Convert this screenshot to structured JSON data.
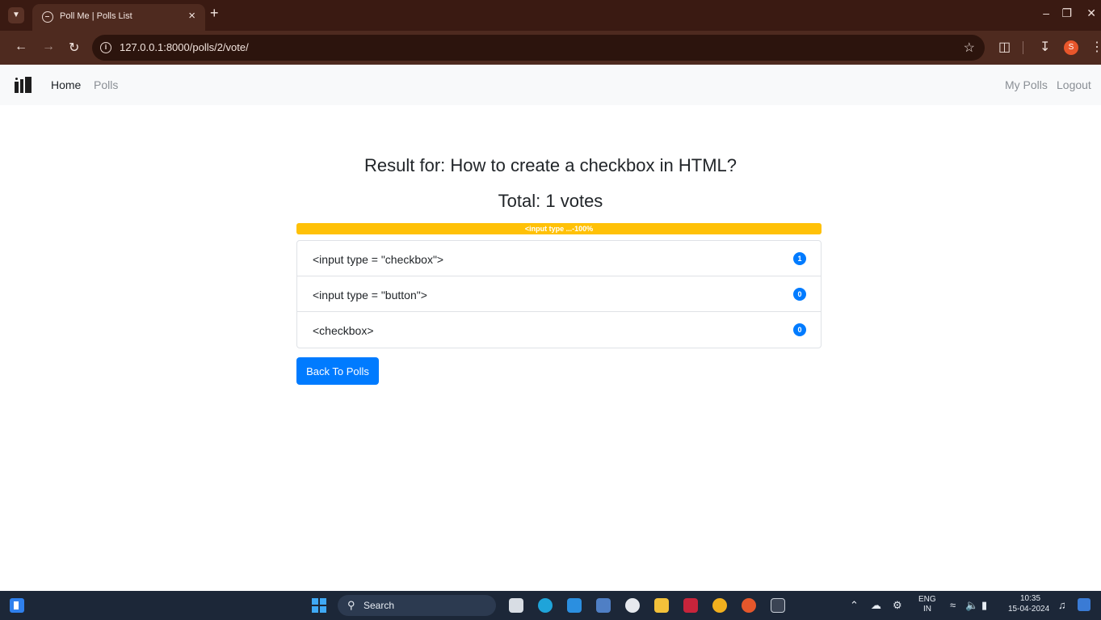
{
  "browser": {
    "tab_title": "Poll Me | Polls List",
    "url": "127.0.0.1:8000/polls/2/vote/",
    "profile_initial": "S"
  },
  "navbar": {
    "home": "Home",
    "polls": "Polls",
    "my_polls": "My Polls",
    "logout": "Logout"
  },
  "main": {
    "result_title": "Result for: How to create a checkbox in HTML?",
    "total": "Total: 1 votes",
    "progress_label": "<input type ...-100%",
    "progress_percent": 100,
    "choices": [
      {
        "text": "<input type = \"checkbox\">",
        "votes": "1"
      },
      {
        "text": "<input type = \"button\">",
        "votes": "0"
      },
      {
        "text": "<checkbox>",
        "votes": "0"
      }
    ],
    "back_button": "Back To Polls"
  },
  "taskbar": {
    "search": "Search",
    "lang_top": "ENG",
    "lang_bottom": "IN",
    "time": "10:35",
    "date": "15-04-2024"
  },
  "colors": {
    "primary": "#007bff",
    "warning": "#ffc107",
    "navbar_bg": "#f8f9fa",
    "browser_frame": "#4e2a1f"
  }
}
